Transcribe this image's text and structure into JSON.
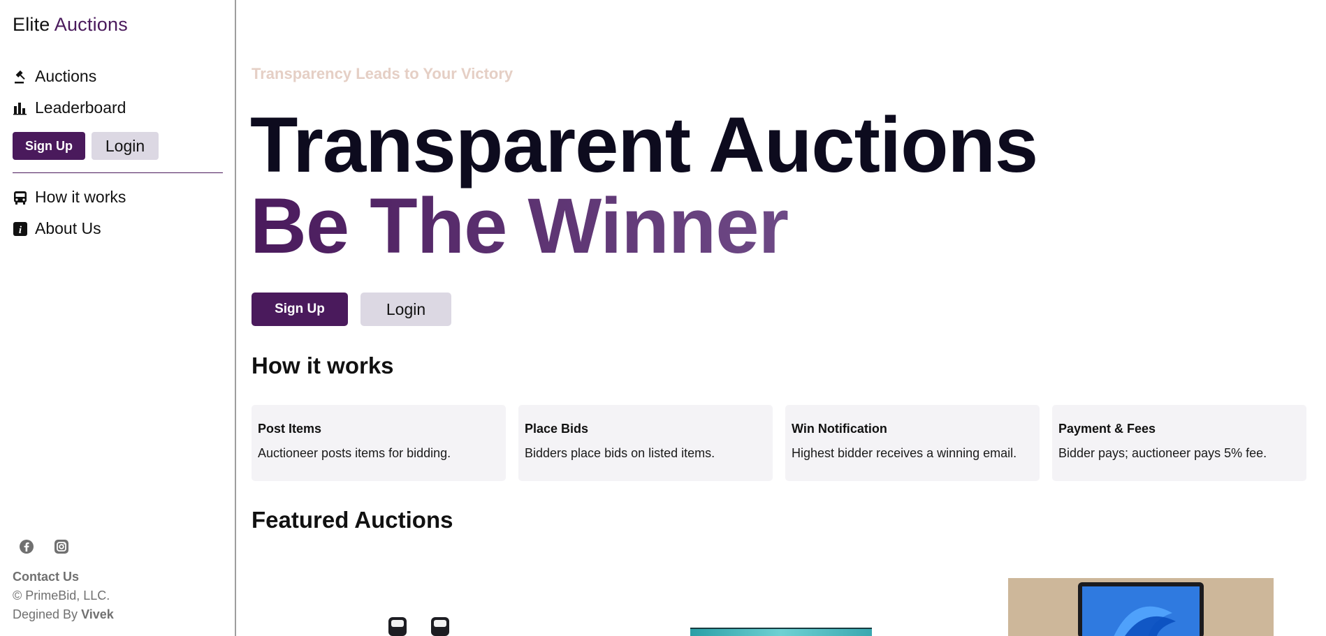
{
  "sidebar": {
    "brand": {
      "part1": "Elite",
      "part2": "Auctions"
    },
    "nav": [
      {
        "label": "Auctions",
        "icon": "gavel-icon"
      },
      {
        "label": "Leaderboard",
        "icon": "bar-chart-icon"
      }
    ],
    "signup_label": "Sign Up",
    "login_label": "Login",
    "nav2": [
      {
        "label": "How it works",
        "icon": "bus-icon"
      },
      {
        "label": "About Us",
        "icon": "info-icon"
      }
    ],
    "socials": [
      "facebook-icon",
      "instagram-icon"
    ],
    "contact": "Contact Us",
    "copyright": "© PrimeBid, LLC.",
    "designed_prefix": "Degined By",
    "designed_name": "Vivek"
  },
  "hero": {
    "tagline": "Transparency Leads to Your Victory",
    "line1": "Transparent Auctions",
    "line2": "Be The Winner",
    "signup_label": "Sign Up",
    "login_label": "Login"
  },
  "how": {
    "heading": "How it works",
    "cards": [
      {
        "title": "Post Items",
        "desc": "Auctioneer posts items for bidding."
      },
      {
        "title": "Place Bids",
        "desc": "Bidders place bids on listed items."
      },
      {
        "title": "Win Notification",
        "desc": "Highest bidder receives a winning email."
      },
      {
        "title": "Payment & Fees",
        "desc": "Bidder pays; auctioneer pays 5% fee."
      }
    ]
  },
  "featured": {
    "heading": "Featured Auctions"
  },
  "colors": {
    "brand": "#4a1a5c",
    "secondary_button": "#dcd8e3",
    "tagline": "#e5cfc5",
    "card_bg": "#f4f3f6"
  }
}
